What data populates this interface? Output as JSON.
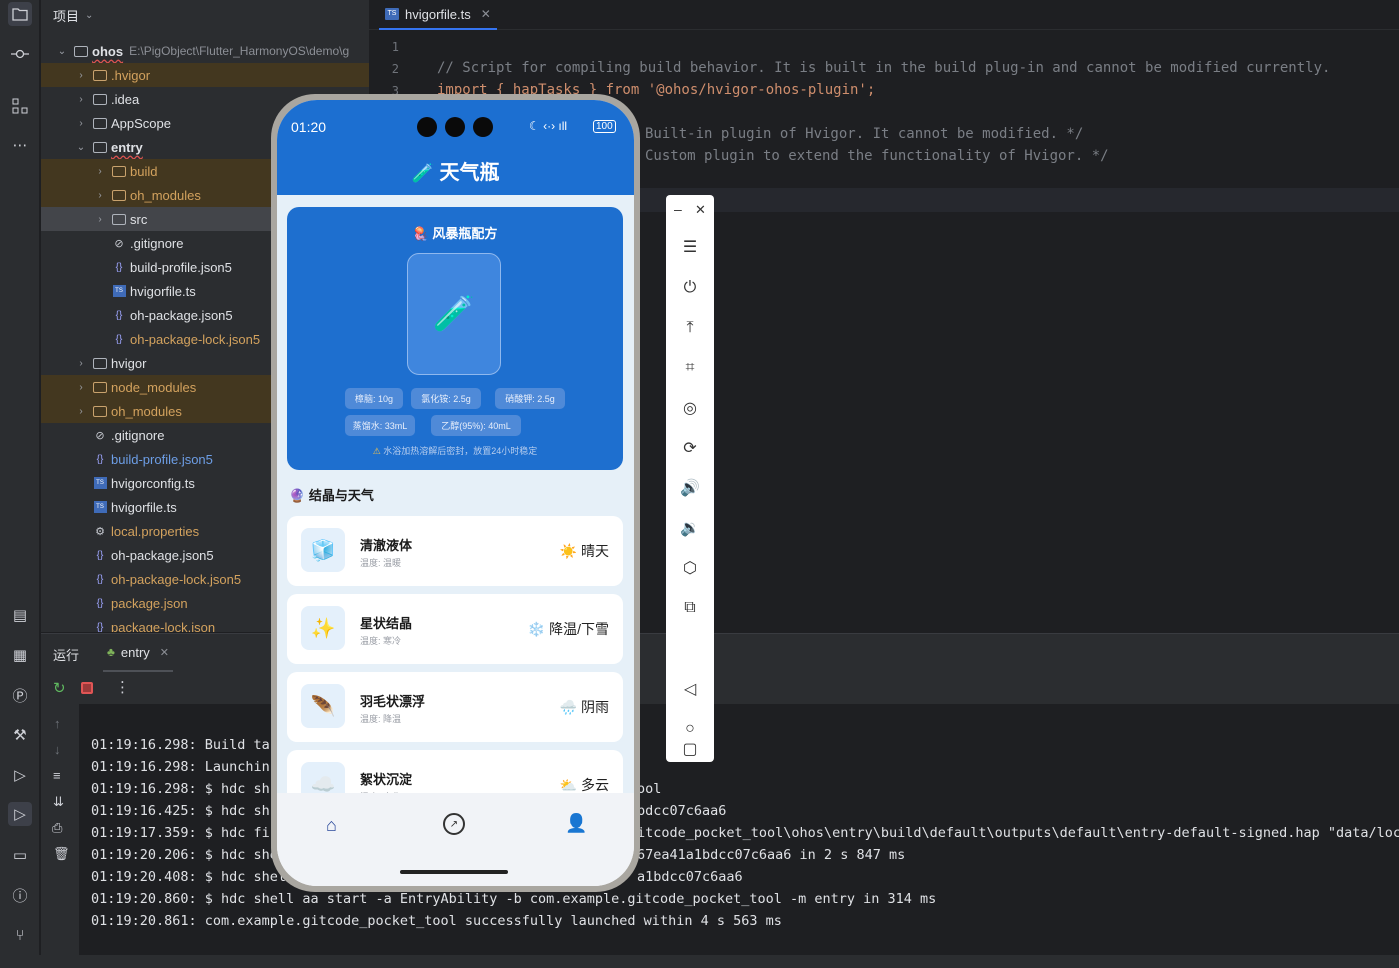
{
  "ide": {
    "project_label": "项目",
    "tree": [
      {
        "depth": 0,
        "chev": "⌄",
        "icon": "module",
        "name": "ohos",
        "path": "E:\\PigObject\\Flutter_HarmonyOS\\demo\\g",
        "style": "bold"
      },
      {
        "depth": 1,
        "chev": "›",
        "icon": "folder",
        "name": ".hvigor",
        "style": "ex"
      },
      {
        "depth": 1,
        "chev": "›",
        "icon": "folder",
        "name": ".idea",
        "style": ""
      },
      {
        "depth": 1,
        "chev": "›",
        "icon": "folder",
        "name": "AppScope",
        "style": ""
      },
      {
        "depth": 1,
        "chev": "⌄",
        "icon": "module",
        "name": "entry",
        "style": "bold"
      },
      {
        "depth": 2,
        "chev": "›",
        "icon": "folder",
        "name": "build",
        "style": "ex"
      },
      {
        "depth": 2,
        "chev": "›",
        "icon": "folder",
        "name": "oh_modules",
        "style": "ex"
      },
      {
        "depth": 2,
        "chev": "›",
        "icon": "folder",
        "name": "src",
        "style": "sel"
      },
      {
        "depth": 2,
        "chev": "",
        "icon": "ignore",
        "name": ".gitignore",
        "style": ""
      },
      {
        "depth": 2,
        "chev": "",
        "icon": "json",
        "name": "build-profile.json5",
        "style": ""
      },
      {
        "depth": 2,
        "chev": "",
        "icon": "ts",
        "name": "hvigorfile.ts",
        "style": ""
      },
      {
        "depth": 2,
        "chev": "",
        "icon": "json",
        "name": "oh-package.json5",
        "style": ""
      },
      {
        "depth": 2,
        "chev": "",
        "icon": "json",
        "name": "oh-package-lock.json5",
        "style": "extext"
      },
      {
        "depth": 1,
        "chev": "›",
        "icon": "folder",
        "name": "hvigor",
        "style": ""
      },
      {
        "depth": 1,
        "chev": "›",
        "icon": "folder",
        "name": "node_modules",
        "style": "ex"
      },
      {
        "depth": 1,
        "chev": "›",
        "icon": "folder",
        "name": "oh_modules",
        "style": "ex"
      },
      {
        "depth": 1,
        "chev": "",
        "icon": "ignore",
        "name": ".gitignore",
        "style": ""
      },
      {
        "depth": 1,
        "chev": "",
        "icon": "json",
        "name": "build-profile.json5",
        "style": "mod"
      },
      {
        "depth": 1,
        "chev": "",
        "icon": "ts",
        "name": "hvigorconfig.ts",
        "style": ""
      },
      {
        "depth": 1,
        "chev": "",
        "icon": "ts",
        "name": "hvigorfile.ts",
        "style": ""
      },
      {
        "depth": 1,
        "chev": "",
        "icon": "gear",
        "name": "local.properties",
        "style": "extext"
      },
      {
        "depth": 1,
        "chev": "",
        "icon": "json",
        "name": "oh-package.json5",
        "style": ""
      },
      {
        "depth": 1,
        "chev": "",
        "icon": "json",
        "name": "oh-package-lock.json5",
        "style": "extext"
      },
      {
        "depth": 1,
        "chev": "",
        "icon": "json",
        "name": "package.json",
        "style": "extext"
      },
      {
        "depth": 1,
        "chev": "",
        "icon": "json",
        "name": "package-lock.json",
        "style": "extext"
      }
    ],
    "editor_tab": "hvigorfile.ts",
    "code_lines": [
      {
        "n": "1",
        "text": ""
      },
      {
        "n": "2",
        "text": "// Script for compiling build behavior. It is built in the build plug-in and cannot be modified currently."
      },
      {
        "n": "3",
        "text": "import { hapTasks } from '@ohos/hvigor-ohos-plugin';"
      }
    ],
    "code_fragments": [
      "Built-in plugin of Hvigor. It cannot be modified. */",
      "Custom plugin to extend the functionality of Hvigor. */"
    ],
    "run_label": "运行",
    "run_tab": "entry",
    "log_lines": [
      "01:19:16.298: Build ta",
      "01:19:16.298: Launchin",
      "01:19:16.298: $ hdc sh",
      "01:19:16.425: $ hdc sh",
      "01:19:17.359: $ hdc fi",
      "01:19:20.206: $ hdc she",
      "01:19:20.408: $ hdc shel",
      "01:19:20.860: $ hdc shell aa start -a EntryAbility -b com.example.gitcode_pocket_tool -m entry in 314 ms",
      "01:19:20.861: com.example.gitcode_pocket_tool successfully launched within 4 s 563 ms"
    ],
    "log_tails": [
      "ool",
      "bdcc07c6aa6",
      "itcode_pocket_tool\\ohos\\entry\\build\\default\\outputs\\default\\entry-default-signed.hap \"data/local/",
      "67ea41a1bdcc07c6aa6 in 2 s 847 ms",
      "a1bdcc07c6aa6"
    ]
  },
  "phone": {
    "time": "01:20",
    "battery": "100",
    "app_title": "天气瓶",
    "recipe_title": "风暴瓶配方",
    "ingredients": [
      "樟脑: 10g",
      "氯化铵: 2.5g",
      "硝酸钾: 2.5g",
      "蒸馏水: 33mL",
      "乙醇(95%): 40mL"
    ],
    "tip": "水浴加热溶解后密封，放置24小时稳定",
    "section_title": "结晶与天气",
    "cards": [
      {
        "icon": "🧊",
        "title": "清澈液体",
        "sub": "温度: 温暖",
        "wicon": "☀️",
        "weather": "晴天"
      },
      {
        "icon": "✨",
        "title": "星状结晶",
        "sub": "温度: 寒冷",
        "wicon": "❄️",
        "weather": "降温/下雪"
      },
      {
        "icon": "🪶",
        "title": "羽毛状漂浮",
        "sub": "温度: 降温",
        "wicon": "🌧️",
        "weather": "阴雨"
      },
      {
        "icon": "☁️",
        "title": "絮状沉淀",
        "sub": "温度: 变化",
        "wicon": "⛅",
        "weather": "多云"
      }
    ]
  },
  "colors": {
    "accent": "#3574f0",
    "phone_header": "#1c6fd1",
    "recipe_card": "#1e6fcf"
  }
}
